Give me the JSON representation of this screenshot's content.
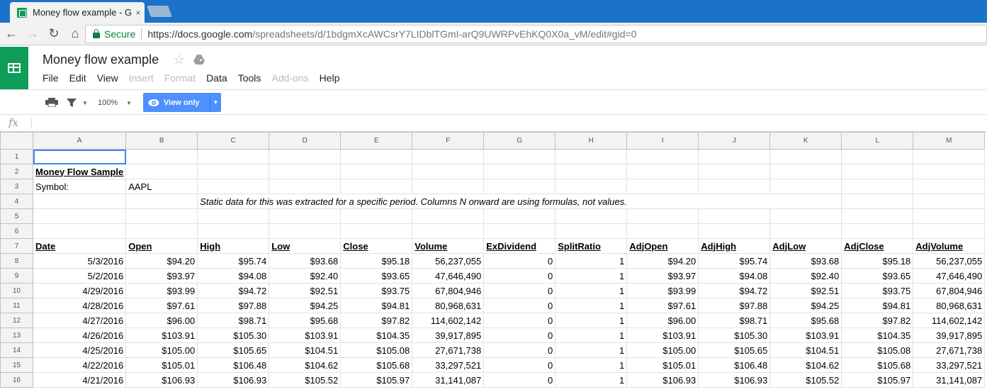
{
  "browser": {
    "tab_title": "Money flow example - G",
    "tab_close": "×",
    "secure_label": "Secure",
    "url_host": "https://docs.google.com",
    "url_path": "/spreadsheets/d/1bdgmXcAWCsrY7LIDblTGmI-arQ9UWRPvEhKQ0X0a_vM/edit#gid=0"
  },
  "app": {
    "doc_title": "Money flow example",
    "menu": [
      "File",
      "Edit",
      "View",
      "Insert",
      "Format",
      "Data",
      "Tools",
      "Add-ons",
      "Help"
    ],
    "menu_disabled": [
      "Insert",
      "Format",
      "Add-ons"
    ]
  },
  "toolbar": {
    "zoom": "100%",
    "view_only_label": "View only"
  },
  "formula_bar": {
    "fx_label": "fx",
    "value": ""
  },
  "sheet": {
    "columns": [
      "A",
      "B",
      "C",
      "D",
      "E",
      "F",
      "G",
      "H",
      "I",
      "J",
      "K",
      "L",
      "M"
    ],
    "title": "Money Flow Sample",
    "symbol_label": "Symbol:",
    "symbol_value": "AAPL",
    "note": "Static data for this was extracted for a specific period. Columns N onward are using formulas, not values.",
    "headers": [
      "Date",
      "Open",
      "High",
      "Low",
      "Close",
      "Volume",
      "ExDividend",
      "SplitRatio",
      "AdjOpen",
      "AdjHigh",
      "AdjLow",
      "AdjClose",
      "AdjVolume"
    ],
    "rows": [
      [
        "5/3/2016",
        "$94.20",
        "$95.74",
        "$93.68",
        "$95.18",
        "56,237,055",
        "0",
        "1",
        "$94.20",
        "$95.74",
        "$93.68",
        "$95.18",
        "56,237,055"
      ],
      [
        "5/2/2016",
        "$93.97",
        "$94.08",
        "$92.40",
        "$93.65",
        "47,646,490",
        "0",
        "1",
        "$93.97",
        "$94.08",
        "$92.40",
        "$93.65",
        "47,646,490"
      ],
      [
        "4/29/2016",
        "$93.99",
        "$94.72",
        "$92.51",
        "$93.75",
        "67,804,946",
        "0",
        "1",
        "$93.99",
        "$94.72",
        "$92.51",
        "$93.75",
        "67,804,946"
      ],
      [
        "4/28/2016",
        "$97.61",
        "$97.88",
        "$94.25",
        "$94.81",
        "80,968,631",
        "0",
        "1",
        "$97.61",
        "$97.88",
        "$94.25",
        "$94.81",
        "80,968,631"
      ],
      [
        "4/27/2016",
        "$96.00",
        "$98.71",
        "$95.68",
        "$97.82",
        "114,602,142",
        "0",
        "1",
        "$96.00",
        "$98.71",
        "$95.68",
        "$97.82",
        "114,602,142"
      ],
      [
        "4/26/2016",
        "$103.91",
        "$105.30",
        "$103.91",
        "$104.35",
        "39,917,895",
        "0",
        "1",
        "$103.91",
        "$105.30",
        "$103.91",
        "$104.35",
        "39,917,895"
      ],
      [
        "4/25/2016",
        "$105.00",
        "$105.65",
        "$104.51",
        "$105.08",
        "27,671,738",
        "0",
        "1",
        "$105.00",
        "$105.65",
        "$104.51",
        "$105.08",
        "27,671,738"
      ],
      [
        "4/22/2016",
        "$105.01",
        "$106.48",
        "$104.62",
        "$105.68",
        "33,297,521",
        "0",
        "1",
        "$105.01",
        "$106.48",
        "$104.62",
        "$105.68",
        "33,297,521"
      ],
      [
        "4/21/2016",
        "$106.93",
        "$106.93",
        "$105.52",
        "$105.97",
        "31,141,087",
        "0",
        "1",
        "$106.93",
        "$106.93",
        "$105.52",
        "$105.97",
        "31,141,087"
      ]
    ]
  },
  "colors": {
    "sheets_green": "#0f9d58",
    "chrome_blue": "#1a73c8",
    "view_only_blue": "#4d90fe",
    "title_red": "#8b1a1a",
    "symbol_blue": "#1155cc"
  }
}
